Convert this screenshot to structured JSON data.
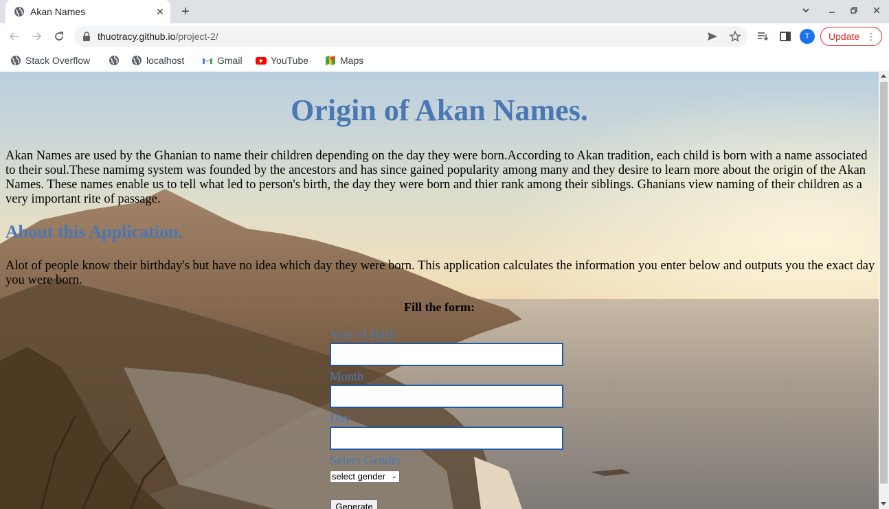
{
  "browser": {
    "tab": {
      "title": "Akan Names",
      "favicon": "globe-icon"
    },
    "url": {
      "host": "thuotracy.github.io",
      "path": "/project-2/"
    },
    "profile_initial": "T",
    "update_label": "Update",
    "bookmarks": [
      {
        "label": "Stack Overflow",
        "icon": "globe-icon"
      },
      {
        "label": "",
        "icon": "globe-icon"
      },
      {
        "label": "localhost",
        "icon": "globe-icon"
      },
      {
        "label": "Gmail",
        "icon": "gmail-icon"
      },
      {
        "label": "YouTube",
        "icon": "youtube-icon"
      },
      {
        "label": "Maps",
        "icon": "maps-icon"
      }
    ]
  },
  "page": {
    "title": "Origin of Akan Names.",
    "intro": "Akan Names are used by the Ghanian to name their children depending on the day they were born.According to Akan tradition, each child is born with a name associated to their soul.These namimg system was founded by the ancestors and has since gained popularity among many and they desire to learn more about the origin of the Akan Names. These names enable us to tell what led to person's birth, the day they were born and thier rank among their siblings. Ghanians view naming of their children as a very important rite of passage.",
    "about_heading": "About this Application.",
    "about_text": "Alot of people know their birthday's but have no idea which day they were born. This application calculates the information you enter below and outputs you the exact day you were born.",
    "form": {
      "heading": "Fill the form:",
      "year_label": "Year of Birth",
      "year_value": "",
      "month_label": "Month",
      "month_value": "",
      "day_label": "Day",
      "day_value": "",
      "gender_label": "Select Gender",
      "gender_selected": "select gender",
      "generate_label": "Generate"
    }
  },
  "colors": {
    "heading": "#4a78b4",
    "input_border": "#1e5aa8",
    "update": "#d93025"
  }
}
